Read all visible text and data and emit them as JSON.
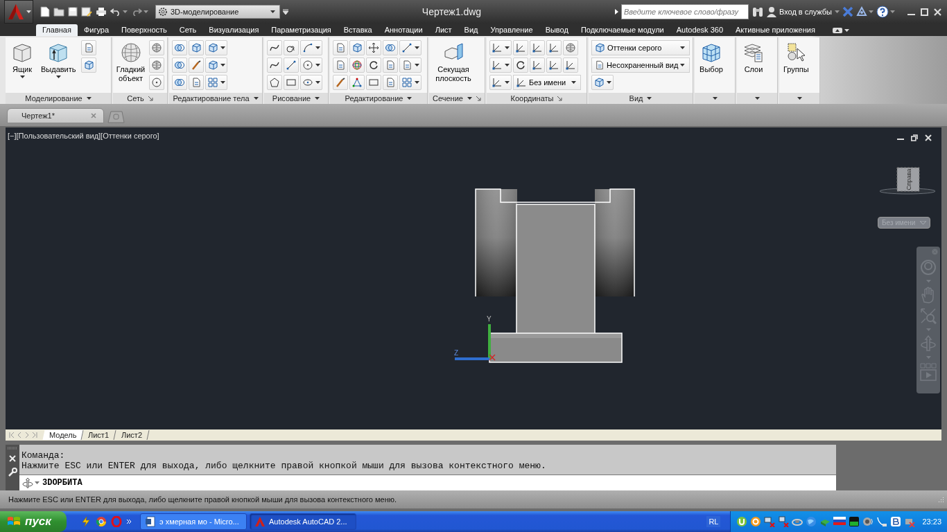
{
  "title_bar": {
    "title": "Чертеж1.dwg",
    "workspace": "3D-моделирование",
    "search": {
      "placeholder": "Введите ключевое слово/фразу"
    },
    "sign_in": "Вход в службы"
  },
  "ribbon_tabs": [
    {
      "label": "Главная",
      "selected": true
    },
    {
      "label": "Фигура",
      "selected": false
    },
    {
      "label": "Поверхность",
      "selected": false
    },
    {
      "label": "Сеть",
      "selected": false
    },
    {
      "label": "Визуализация",
      "selected": false
    },
    {
      "label": "Параметризация",
      "selected": false
    },
    {
      "label": "Вставка",
      "selected": false
    },
    {
      "label": "Аннотации",
      "selected": false
    },
    {
      "label": "Лист",
      "selected": false
    },
    {
      "label": "Вид",
      "selected": false
    },
    {
      "label": "Управление",
      "selected": false
    },
    {
      "label": "Вывод",
      "selected": false
    },
    {
      "label": "Подключаемые модули",
      "selected": false
    },
    {
      "label": "Autodesk 360",
      "selected": false
    },
    {
      "label": "Активные приложения",
      "selected": false
    }
  ],
  "ribbon_panels": [
    {
      "title": "Моделирование",
      "buttons": [
        "Ящик",
        "Выдавить"
      ]
    },
    {
      "title": "Сеть",
      "buttons": [
        "Гладкий объект"
      ]
    },
    {
      "title": "Редактирование тела"
    },
    {
      "title": "Рисование"
    },
    {
      "title": "Редактирование"
    },
    {
      "title": "Сечение",
      "buttons": [
        "Секущая плоскость"
      ]
    },
    {
      "title": "Координаты",
      "fields": [
        "Без имени"
      ]
    },
    {
      "title": "Вид",
      "fields": [
        "Оттенки серого",
        "Несохраненный вид"
      ]
    },
    {
      "buttons": [
        "Выбор"
      ]
    },
    {
      "buttons": [
        "Слои"
      ]
    },
    {
      "buttons": [
        "Группы"
      ]
    }
  ],
  "document_tabs": [
    {
      "label": "Чертеж1*",
      "selected": true
    }
  ],
  "viewport": {
    "controls": [
      "[−]",
      "[Пользовательский вид]",
      "[Оттенки серого]"
    ],
    "viewcube_face": "Справа",
    "ucs_menu": "Без имени",
    "axis_labels": [
      "Y",
      "Z"
    ]
  },
  "layout_tabs": [
    {
      "label": "Модель",
      "selected": true
    },
    {
      "label": "Лист1",
      "selected": false
    },
    {
      "label": "Лист2",
      "selected": false
    }
  ],
  "command_line": {
    "history": [
      "Команда:",
      "Нажмите ESC или ENTER для выхода, либо щелкните правой кнопкой мыши для вызова контекстного меню."
    ],
    "input": "3DОРБИТА"
  },
  "status_bar": {
    "message": "Нажмите ESC или ENTER для выхода, либо щелкните правой кнопкой мыши для вызова контекстного меню."
  },
  "taskbar": {
    "start": "пуск",
    "tasks": [
      {
        "label": "э хмерная мо - Micro...",
        "selected": false
      },
      {
        "label": "Autodesk AutoCAD 2...",
        "selected": true
      }
    ],
    "language": "RL",
    "clock": "23:23"
  }
}
